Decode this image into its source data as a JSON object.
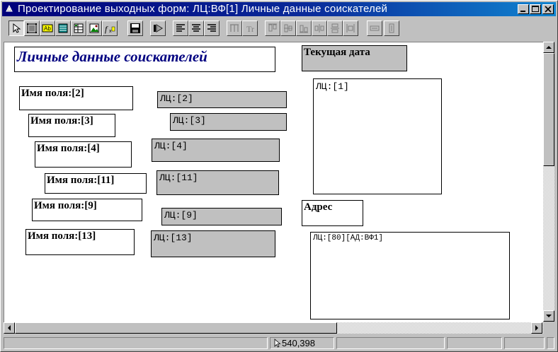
{
  "window": {
    "title": "Проектирование выходных форм: ЛЦ:ВФ[1] Личные данные соискателей",
    "controls": [
      "minimize-icon",
      "maximize-icon",
      "close-icon"
    ]
  },
  "toolbar": {
    "groups": [
      [
        "pointer-icon",
        "frame-icon",
        "label-icon",
        "list-icon",
        "table-icon",
        "image-icon",
        "formula-icon"
      ],
      [
        "save-icon",
        "next-icon"
      ],
      [
        "align-left-icon",
        "align-center-icon",
        "align-right-icon"
      ],
      [
        "format-disabled-icon",
        "text-disabled-icon"
      ],
      [
        "align-top-disabled-icon",
        "align-middle-disabled-icon",
        "align-bottom-disabled-icon",
        "distribute-h-disabled-icon",
        "distribute-v-disabled-icon",
        "equal-space-disabled-icon"
      ],
      [
        "same-width-disabled-icon",
        "same-height-disabled-icon"
      ]
    ]
  },
  "form": {
    "title": "Личные данные соискателей",
    "date_label": "Текущая дата",
    "address_label": "Адрес",
    "fields": [
      {
        "label": "Имя поля:[2]",
        "value": "ЛЦ:[2]"
      },
      {
        "label": "Имя поля:[3]",
        "value": "ЛЦ:[3]"
      },
      {
        "label": "Имя поля:[4]",
        "value": "ЛЦ:[4]"
      },
      {
        "label": "Имя поля:[11]",
        "value": "ЛЦ:[11]"
      },
      {
        "label": "Имя поля:[9]",
        "value": "ЛЦ:[9]"
      },
      {
        "label": "Имя поля:[13]",
        "value": "ЛЦ:[13]"
      }
    ],
    "photo_field": "ЛЦ:[1]",
    "address_field": "ЛЦ:[80][АД:ВФ1]"
  },
  "status": {
    "coords": "540,398"
  },
  "colors": {
    "title_blue": "#00007a",
    "form_title_text": "#000080",
    "field_gray": "#c0c0c0"
  }
}
